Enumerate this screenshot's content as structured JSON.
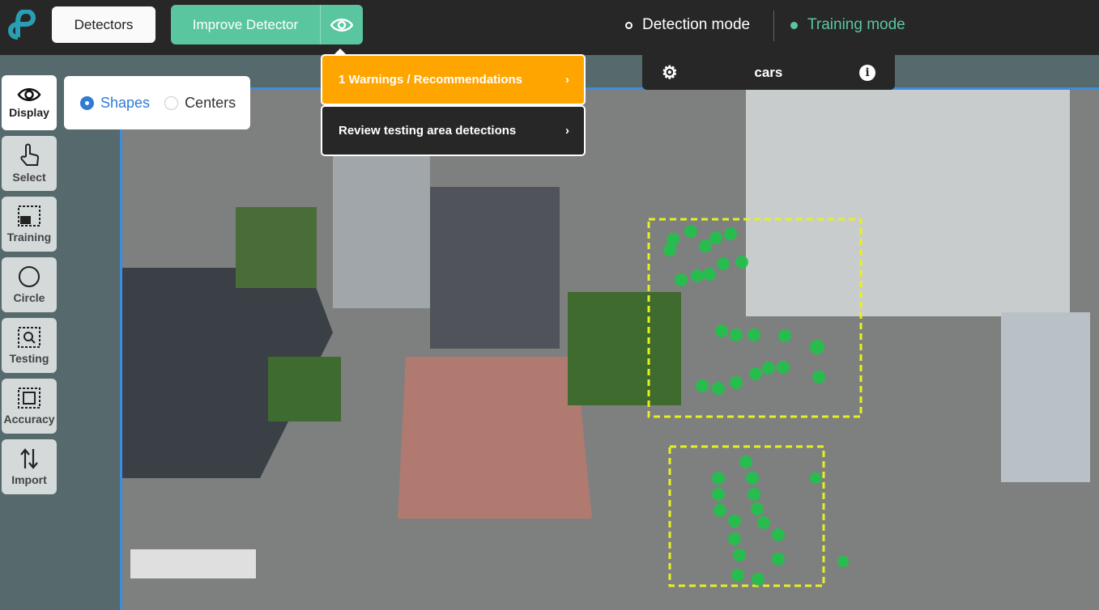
{
  "header": {
    "detectors_label": "Detectors",
    "improve_label": "Improve Detector",
    "detection_mode": "Detection mode",
    "training_mode": "Training mode"
  },
  "category": {
    "name": "cars"
  },
  "colors": {
    "accent": "#5ac6a0",
    "warning": "#ffa500",
    "selection": "#e6f020",
    "detection": "#1fc34a"
  },
  "dropdown": {
    "items": [
      {
        "label": "1 Warnings / Recommendations"
      },
      {
        "label": "Review testing area detections"
      }
    ]
  },
  "display": {
    "options": [
      {
        "label": "Shapes",
        "selected": true
      },
      {
        "label": "Centers",
        "selected": false
      }
    ]
  },
  "tools": [
    {
      "label": "Display",
      "icon": "eye-icon"
    },
    {
      "label": "Select",
      "icon": "hand-pointer-icon"
    },
    {
      "label": "Training",
      "icon": "training-area-icon"
    },
    {
      "label": "Circle",
      "icon": "circle-icon"
    },
    {
      "label": "Testing",
      "icon": "testing-area-icon"
    },
    {
      "label": "Accuracy",
      "icon": "accuracy-icon"
    },
    {
      "label": "Import",
      "icon": "import-icon"
    }
  ]
}
